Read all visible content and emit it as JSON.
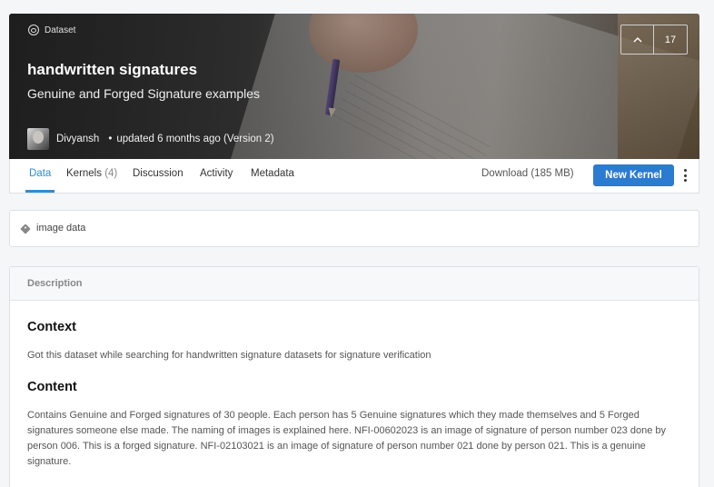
{
  "header": {
    "type_label": "Dataset",
    "title": "handwritten signatures",
    "subtitle": "Genuine and Forged Signature examples",
    "author": "Divyansh",
    "separator": "•",
    "updated": "updated 6 months ago (Version 2)",
    "votes": "17",
    "upvote_icon": "chevron-up"
  },
  "tabs": [
    {
      "label": "Data",
      "count": ""
    },
    {
      "label": "Kernels",
      "count": "(4)"
    },
    {
      "label": "Discussion",
      "count": ""
    },
    {
      "label": "Activity",
      "count": ""
    },
    {
      "label": "Metadata",
      "count": ""
    }
  ],
  "actions": {
    "download": "Download (185 MB)",
    "new_kernel": "New Kernel"
  },
  "tags": {
    "items": [
      "image data"
    ]
  },
  "description": {
    "header": "Description",
    "sections": [
      {
        "heading": "Context",
        "text": "Got this dataset while searching for handwritten signature datasets for signature verification"
      },
      {
        "heading": "Content",
        "text": "Contains Genuine and Forged signatures of 30 people. Each person has 5 Genuine signatures which they made themselves and 5 Forged signatures someone else made. The naming of images is explained here. NFI-00602023 is an image of signature of person number 023 done by person 006. This is a forged signature. NFI-02103021 is an image of signature of person number 021 done by person 021. This is a genuine signature."
      }
    ]
  },
  "colors": {
    "accent": "#2f8dd6",
    "button": "#2b7bd1"
  }
}
